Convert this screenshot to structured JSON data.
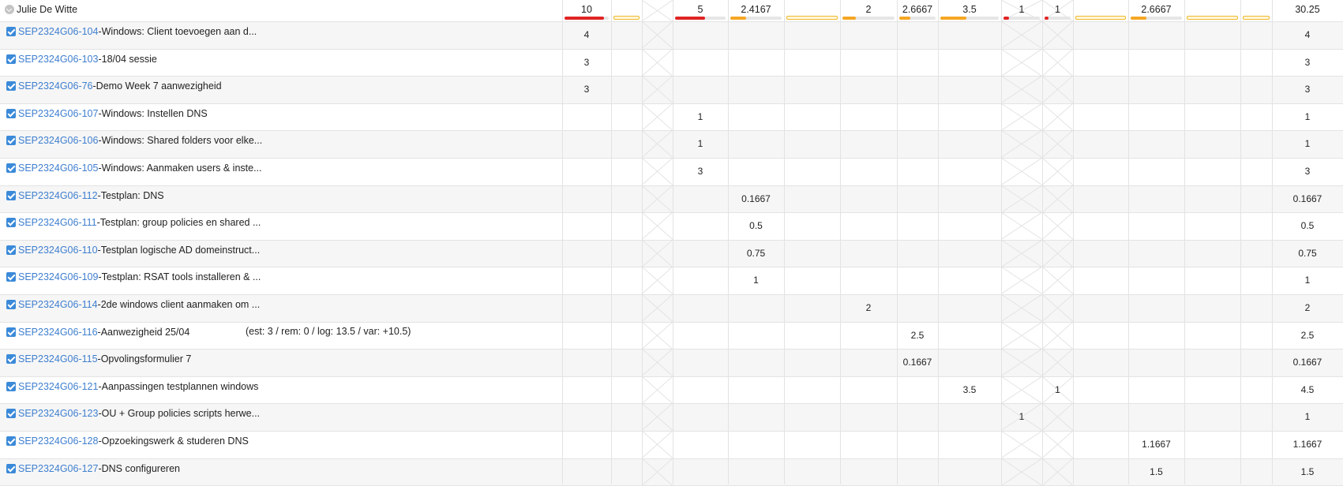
{
  "user": {
    "name": "Julie De Witte"
  },
  "columns": [
    {
      "type": "data",
      "total": "10",
      "fill": 0.9,
      "color": "#e02424"
    },
    {
      "type": "data",
      "total": "",
      "empty": true
    },
    {
      "type": "weekend"
    },
    {
      "type": "data",
      "total": "5",
      "fill": 0.6,
      "color": "#e02424"
    },
    {
      "type": "data",
      "total": "2.4167",
      "fill": 0.3,
      "color": "#f5a623"
    },
    {
      "type": "data",
      "total": "",
      "empty": true
    },
    {
      "type": "data",
      "total": "2",
      "fill": 0.25,
      "color": "#f5a623"
    },
    {
      "type": "data",
      "total": "2.6667",
      "fill": 0.3,
      "color": "#f5a623"
    },
    {
      "type": "data",
      "total": "3.5",
      "fill": 0.45,
      "color": "#f5a623"
    },
    {
      "type": "weekend",
      "total": "1",
      "fill": 0.15,
      "color": "#e02424"
    },
    {
      "type": "weekend",
      "total": "1",
      "fill": 0.15,
      "color": "#e02424"
    },
    {
      "type": "data",
      "total": "",
      "empty": true
    },
    {
      "type": "data",
      "total": "2.6667",
      "fill": 0.3,
      "color": "#f5a623"
    },
    {
      "type": "data",
      "total": "",
      "empty": true
    },
    {
      "type": "data",
      "total": "",
      "empty": true
    },
    {
      "type": "total",
      "total": "30.25"
    }
  ],
  "rows": [
    {
      "key": "SEP2324G06-104",
      "summary": " -Windows: Client toevoegen aan d...",
      "note": "",
      "values": [
        "4",
        "",
        "",
        "",
        "",
        "",
        "",
        "",
        "",
        "",
        "",
        "",
        "",
        "",
        "",
        ""
      ],
      "total": "4"
    },
    {
      "key": "SEP2324G06-103",
      "summary": " -18/04 sessie",
      "note": "",
      "values": [
        "3",
        "",
        "",
        "",
        "",
        "",
        "",
        "",
        "",
        "",
        "",
        "",
        "",
        "",
        "",
        ""
      ],
      "total": "3"
    },
    {
      "key": "SEP2324G06-76",
      "summary": " -Demo Week 7 aanwezigheid",
      "note": "",
      "values": [
        "3",
        "",
        "",
        "",
        "",
        "",
        "",
        "",
        "",
        "",
        "",
        "",
        "",
        "",
        "",
        ""
      ],
      "total": "3"
    },
    {
      "key": "SEP2324G06-107",
      "summary": " -Windows: Instellen DNS",
      "note": "",
      "values": [
        "",
        "",
        "",
        "1",
        "",
        "",
        "",
        "",
        "",
        "",
        "",
        "",
        "",
        "",
        "",
        ""
      ],
      "total": "1"
    },
    {
      "key": "SEP2324G06-106",
      "summary": " -Windows: Shared folders voor elke...",
      "note": "",
      "values": [
        "",
        "",
        "",
        "1",
        "",
        "",
        "",
        "",
        "",
        "",
        "",
        "",
        "",
        "",
        "",
        ""
      ],
      "total": "1"
    },
    {
      "key": "SEP2324G06-105",
      "summary": " -Windows: Aanmaken users & inste...",
      "note": "",
      "values": [
        "",
        "",
        "",
        "3",
        "",
        "",
        "",
        "",
        "",
        "",
        "",
        "",
        "",
        "",
        "",
        ""
      ],
      "total": "3"
    },
    {
      "key": "SEP2324G06-112",
      "summary": " -Testplan: DNS",
      "note": "",
      "values": [
        "",
        "",
        "",
        "",
        "0.1667",
        "",
        "",
        "",
        "",
        "",
        "",
        "",
        "",
        "",
        "",
        ""
      ],
      "total": "0.1667"
    },
    {
      "key": "SEP2324G06-111",
      "summary": " -Testplan: group policies en shared ...",
      "note": "",
      "values": [
        "",
        "",
        "",
        "",
        "0.5",
        "",
        "",
        "",
        "",
        "",
        "",
        "",
        "",
        "",
        "",
        ""
      ],
      "total": "0.5"
    },
    {
      "key": "SEP2324G06-110",
      "summary": " -Testplan logische AD domeinstruct...",
      "note": "",
      "values": [
        "",
        "",
        "",
        "",
        "0.75",
        "",
        "",
        "",
        "",
        "",
        "",
        "",
        "",
        "",
        "",
        ""
      ],
      "total": "0.75"
    },
    {
      "key": "SEP2324G06-109",
      "summary": " -Testplan: RSAT tools installeren & ...",
      "note": "",
      "values": [
        "",
        "",
        "",
        "",
        "1",
        "",
        "",
        "",
        "",
        "",
        "",
        "",
        "",
        "",
        "",
        ""
      ],
      "total": "1"
    },
    {
      "key": "SEP2324G06-114",
      "summary": " -2de windows client aanmaken om ...",
      "note": "",
      "values": [
        "",
        "",
        "",
        "",
        "",
        "",
        "2",
        "",
        "",
        "",
        "",
        "",
        "",
        "",
        "",
        ""
      ],
      "total": "2"
    },
    {
      "key": "SEP2324G06-116",
      "summary": " -Aanwezigheid 25/04",
      "note": "(est: 3 / rem: 0 / log: 13.5 / var: +10.5)",
      "values": [
        "",
        "",
        "",
        "",
        "",
        "",
        "",
        "2.5",
        "",
        "",
        "",
        "",
        "",
        "",
        "",
        ""
      ],
      "total": "2.5"
    },
    {
      "key": "SEP2324G06-115",
      "summary": " -Opvolingsformulier 7",
      "note": "",
      "values": [
        "",
        "",
        "",
        "",
        "",
        "",
        "",
        "0.1667",
        "",
        "",
        "",
        "",
        "",
        "",
        "",
        ""
      ],
      "total": "0.1667"
    },
    {
      "key": "SEP2324G06-121",
      "summary": " -Aanpassingen testplannen windows",
      "note": "",
      "values": [
        "",
        "",
        "",
        "",
        "",
        "",
        "",
        "",
        "3.5",
        "",
        "1",
        "",
        "",
        "",
        "",
        ""
      ],
      "total": "4.5"
    },
    {
      "key": "SEP2324G06-123",
      "summary": " -OU + Group policies scripts herwe...",
      "note": "",
      "values": [
        "",
        "",
        "",
        "",
        "",
        "",
        "",
        "",
        "",
        "1",
        "",
        "",
        "",
        "",
        "",
        ""
      ],
      "total": "1"
    },
    {
      "key": "SEP2324G06-128",
      "summary": " -Opzoekingswerk & studeren DNS",
      "note": "",
      "values": [
        "",
        "",
        "",
        "",
        "",
        "",
        "",
        "",
        "",
        "",
        "",
        "",
        "1.1667",
        "",
        "",
        ""
      ],
      "total": "1.1667"
    },
    {
      "key": "SEP2324G06-127",
      "summary": " -DNS configureren",
      "note": "",
      "values": [
        "",
        "",
        "",
        "",
        "",
        "",
        "",
        "",
        "",
        "",
        "",
        "",
        "1.5",
        "",
        "",
        ""
      ],
      "total": "1.5"
    }
  ]
}
